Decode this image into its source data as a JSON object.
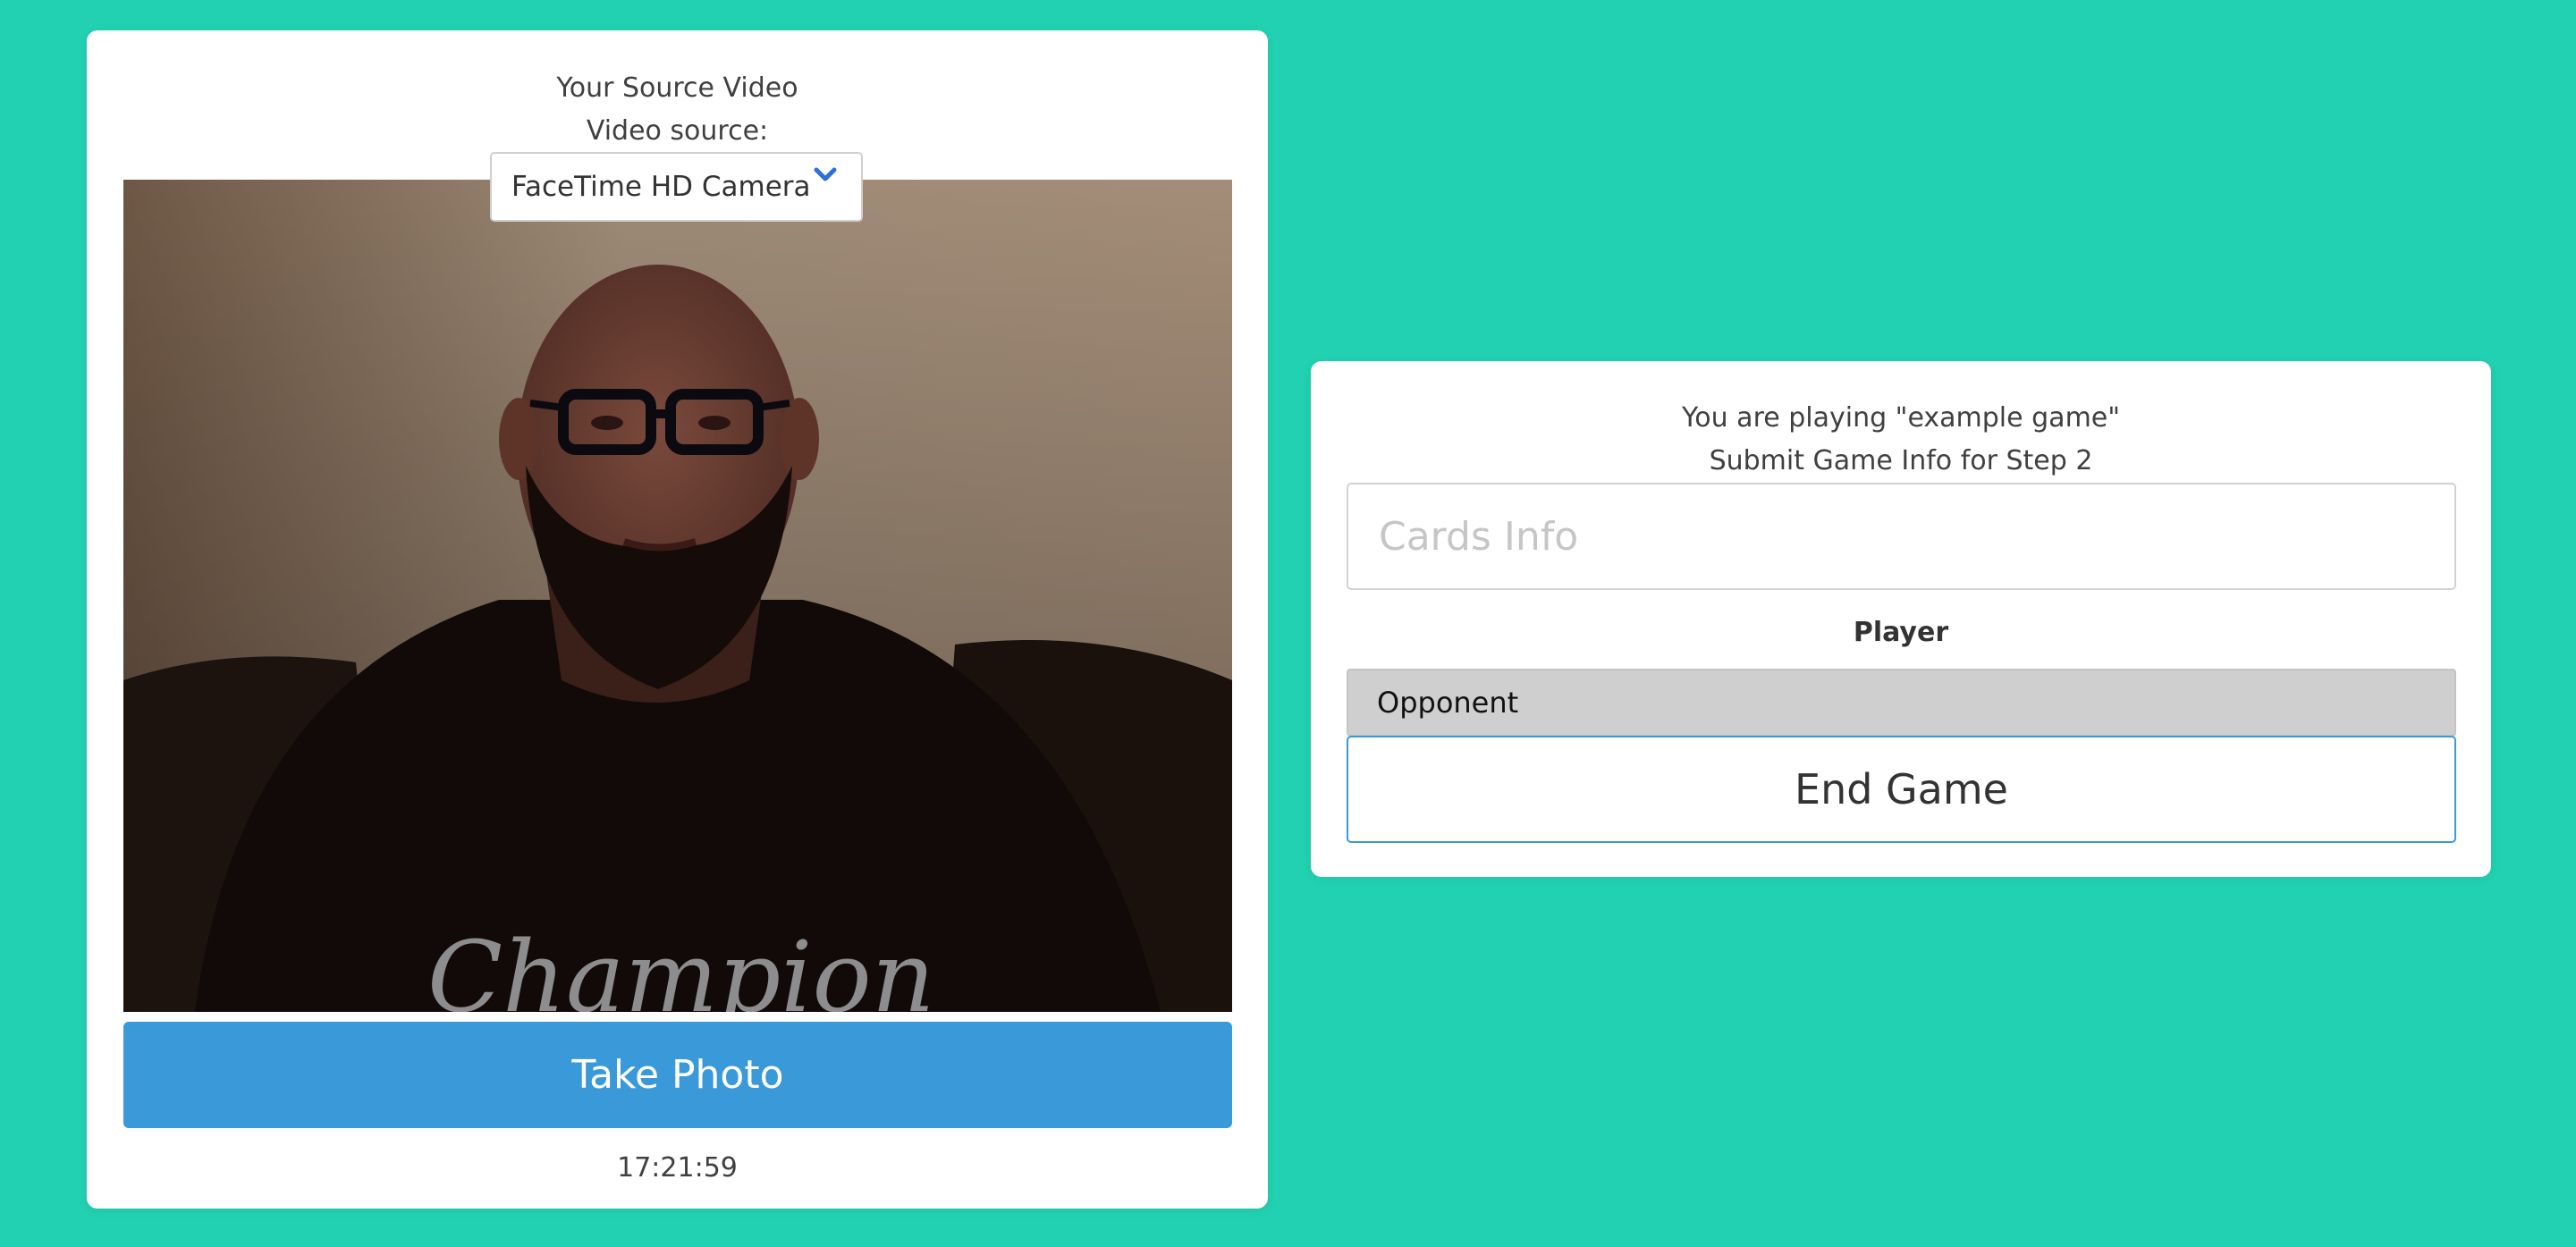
{
  "video_panel": {
    "title": "Your Source Video",
    "source_label": "Video source:",
    "source_selected": "FaceTime HD Camera",
    "take_photo_label": "Take Photo",
    "timestamp": "17:21:59",
    "shirt_logo_text": "Champion"
  },
  "game_panel": {
    "playing_text": "You are playing \"example game\"",
    "step_text": "Submit Game Info for Step 2",
    "cards_info_placeholder": "Cards Info",
    "cards_info_value": "",
    "player_label": "Player",
    "player_option_selected": "Opponent",
    "end_game_label": "End Game"
  },
  "colors": {
    "background": "#22d1b1",
    "card": "#ffffff",
    "primary_button": "#3a99d8",
    "selected_option": "#cfcfcf"
  },
  "icons": {
    "select_chevron": "chevron-down-icon"
  }
}
